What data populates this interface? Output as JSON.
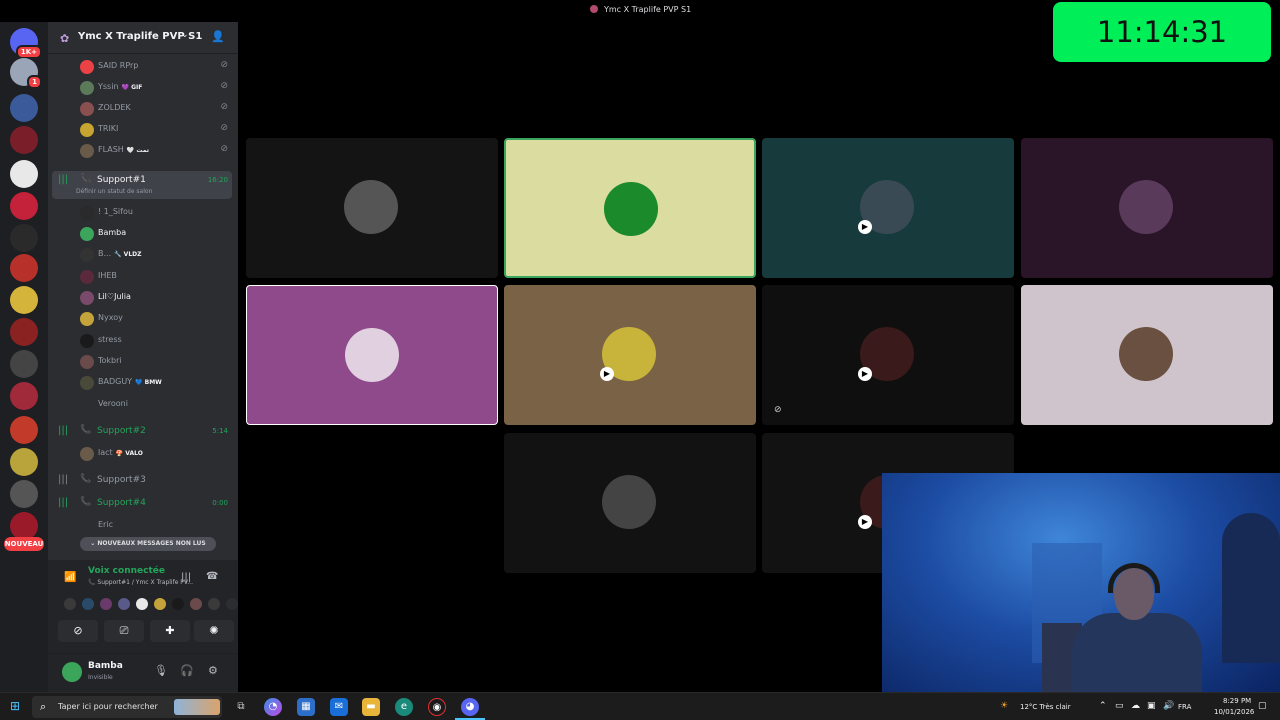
{
  "window": {
    "title": "Ymc X Traplife PVP S1"
  },
  "clock": {
    "time": "11:14:31"
  },
  "server_rail": {
    "servers": [
      {
        "icon": "discord-home-icon",
        "badge": "1K+",
        "color": "#5865f2"
      },
      {
        "icon": "server-icon",
        "badge": "1",
        "color": "#9aa6b8"
      },
      {
        "icon": "server-icon",
        "badge": "",
        "color": "#3b5a9a"
      },
      {
        "icon": "server-icon",
        "badge": "",
        "color": "#7a1e2a"
      },
      {
        "icon": "server-icon",
        "badge": "",
        "color": "#e8e8e8"
      },
      {
        "icon": "server-icon",
        "badge": "",
        "color": "#c4213a"
      },
      {
        "icon": "server-icon",
        "badge": "",
        "color": "#2a2a2a"
      },
      {
        "icon": "server-icon",
        "badge": "",
        "color": "#b8302a"
      },
      {
        "icon": "server-icon",
        "badge": "",
        "color": "#d4b43a"
      },
      {
        "icon": "server-icon",
        "badge": "",
        "color": "#8a2222"
      },
      {
        "icon": "server-icon",
        "badge": "",
        "color": "#444"
      },
      {
        "icon": "server-icon",
        "badge": "",
        "color": "#a02a3a"
      },
      {
        "icon": "server-icon",
        "badge": "",
        "color": "#c23a2a"
      },
      {
        "icon": "server-icon",
        "badge": "",
        "color": "#b8a43a"
      },
      {
        "icon": "server-icon",
        "badge": "",
        "color": "#555"
      },
      {
        "icon": "server-icon",
        "badge": "",
        "color": "#9a1a2a"
      }
    ],
    "new_badge": "NOUVEAU"
  },
  "sidebar": {
    "server_name": "Ymc X Traplife PVP S1",
    "top_members": [
      {
        "name": "SAID RPrp",
        "tag": "",
        "color": "#ed4245"
      },
      {
        "name": "Yssin",
        "tag": "💜 GIF",
        "color": "#5a7a5a"
      },
      {
        "name": "ZOLDEK",
        "tag": "",
        "color": "#8a5050"
      },
      {
        "name": "TRIKI",
        "tag": "",
        "color": "#c8a430"
      },
      {
        "name": "FLASH",
        "tag": "🤍 تمت",
        "color": "#6a5a4a"
      }
    ],
    "support1": {
      "name": "Support#1",
      "time": "16:20",
      "status_hint": "Définir un statut de salon",
      "members": [
        {
          "name": "! 1_Sifou",
          "tag": "",
          "color": "#2a2a2a",
          "active": false
        },
        {
          "name": "Bamba",
          "tag": "",
          "color": "#3ba55c",
          "active": true
        },
        {
          "name": "B...",
          "tag": "🔧 VLDZ",
          "color": "#333",
          "active": false
        },
        {
          "name": "IHEB",
          "tag": "",
          "color": "#5a2a3a",
          "active": false
        },
        {
          "name": "Lil♡Julia",
          "tag": "",
          "color": "#7a4a6a",
          "active": true
        },
        {
          "name": "Nyxoy",
          "tag": "",
          "color": "#c4a43a",
          "active": false
        },
        {
          "name": "stress",
          "tag": "",
          "color": "#1a1a1a",
          "active": false
        },
        {
          "name": "Tokbri",
          "tag": "",
          "color": "#6a4a4a",
          "active": false
        },
        {
          "name": "BADGUY",
          "tag": "💙 BMW",
          "color": "#4a4a3a",
          "active": false
        },
        {
          "name": "Veroonі",
          "tag": "",
          "color": "#2b2d31",
          "active": false
        }
      ]
    },
    "support2": {
      "name": "Support#2",
      "time": "5:14",
      "member": {
        "name": "lact",
        "tag": "🍄 VALO"
      }
    },
    "support3": {
      "name": "Support#3"
    },
    "support4": {
      "name": "Support#4",
      "time": "0:00",
      "member": {
        "name": "Eric"
      }
    },
    "unread": "NOUVEAUX MESSAGES NON LUS"
  },
  "voice_panel": {
    "status": "Voix connectée",
    "location": "Support#1 / Ymc X Traplife PV...",
    "avatars": [
      "#3a3a3a",
      "#2a4a6a",
      "#6a3a6a",
      "#5a5a8a",
      "#e8e8e8",
      "#c4a43a",
      "#1a1a1a",
      "#6a4a4a",
      "#3a3a3a",
      "#2b2d31"
    ]
  },
  "user_panel": {
    "name": "Bamba",
    "status": "Invisible"
  },
  "tiles": [
    {
      "bg": "#141414",
      "avatar": "#555",
      "speaking": false,
      "self": false,
      "cam_badge": false,
      "muted": false
    },
    {
      "bg": "#dbdca0",
      "avatar": "#1a8a2a",
      "speaking": true,
      "self": false,
      "cam_badge": false,
      "muted": false
    },
    {
      "bg": "#173a3c",
      "avatar": "#3a4a55",
      "speaking": false,
      "self": false,
      "cam_badge": true,
      "muted": false
    },
    {
      "bg": "#2a1428",
      "avatar": "#5a3a5a",
      "speaking": false,
      "self": false,
      "cam_badge": false,
      "muted": false
    },
    {
      "bg": "#8e4a8a",
      "avatar": "#e0d0e0",
      "speaking": false,
      "self": true,
      "cam_badge": false,
      "muted": false
    },
    {
      "bg": "#7a6246",
      "avatar": "#c8b43a",
      "speaking": false,
      "self": false,
      "cam_badge": true,
      "muted": false
    },
    {
      "bg": "#0f0f0f",
      "avatar": "#3a1a1a",
      "speaking": false,
      "self": false,
      "cam_badge": true,
      "muted": true
    },
    {
      "bg": "#d0c4cc",
      "avatar": "#6a5040",
      "speaking": false,
      "self": false,
      "cam_badge": false,
      "muted": false
    },
    {
      "bg": "#121212",
      "avatar": "#444",
      "speaking": false,
      "self": false,
      "cam_badge": false,
      "muted": false
    },
    {
      "bg": "#121212",
      "avatar": "#3a1a1a",
      "speaking": false,
      "self": false,
      "cam_badge": true,
      "muted": false
    }
  ],
  "taskbar": {
    "search_placeholder": "Taper ici pour rechercher",
    "weather": "12°C  Très clair",
    "lang": "FRA",
    "time": "8:29 PM",
    "date": "10/01/2026"
  }
}
